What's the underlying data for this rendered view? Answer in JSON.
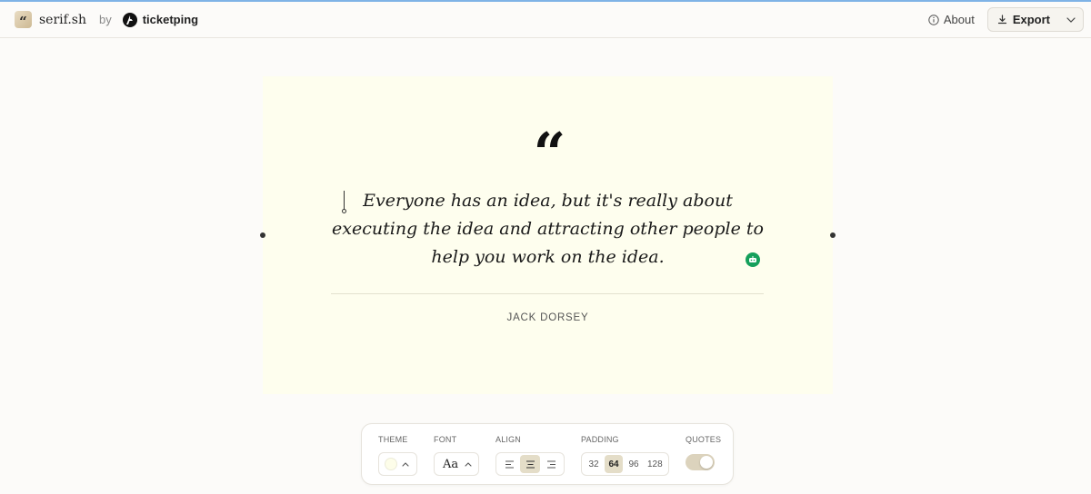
{
  "header": {
    "app_name": "serif.sh",
    "by": "by",
    "partner_name": "ticketping",
    "about_label": "About",
    "export_label": "Export"
  },
  "card": {
    "quote": "Everyone has an idea, but it's really about executing the idea and attracting other people to help you work on the idea.",
    "author": "JACK DORSEY",
    "background": "#fefeee"
  },
  "toolbar": {
    "theme": {
      "label": "THEME",
      "swatch_color": "#fdfde9"
    },
    "font": {
      "label": "FONT",
      "value": "Aa"
    },
    "align": {
      "label": "ALIGN",
      "options": [
        "left",
        "center",
        "right"
      ],
      "selected": "center"
    },
    "padding": {
      "label": "PADDING",
      "options": [
        "32",
        "64",
        "96",
        "128"
      ],
      "selected": "64"
    },
    "quotes": {
      "label": "QUOTES",
      "enabled": true
    }
  },
  "colors": {
    "page_bg": "#fcfbf9",
    "accent_active": "#e4ddc8",
    "grammar_badge": "#15a05b",
    "top_line": "#7fb3e6"
  },
  "icons": {
    "logo": "quote-logo-icon",
    "partner_logo": "ticketping-logo-icon",
    "about": "info-icon",
    "export": "download-icon",
    "export_menu": "chevron-down-icon"
  }
}
